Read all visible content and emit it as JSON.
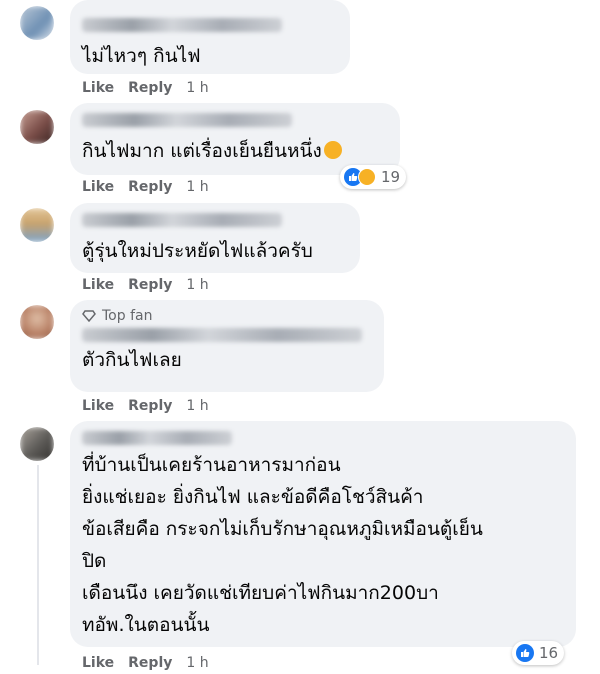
{
  "comments": [
    {
      "text": "ไม่ไหวๆ กินไฟ",
      "actions": {
        "like": "Like",
        "reply": "Reply",
        "time": "1 h"
      },
      "avatar_colors": [
        "#6d8fb3",
        "#b9c7d6"
      ]
    },
    {
      "text": "กินไฟมาก แต่เรื่องเย็นยืนหนึ่ง",
      "actions": {
        "like": "Like",
        "reply": "Reply",
        "time": "1 h"
      },
      "reactions": {
        "count": "19",
        "icons": [
          "like-icon",
          "haha-icon"
        ]
      },
      "avatar_colors": [
        "#7a4d48",
        "#c79f94"
      ]
    },
    {
      "text": "ตู้รุ่นใหม่ประหยัดไฟแล้วครับ",
      "actions": {
        "like": "Like",
        "reply": "Reply",
        "time": "1 h"
      },
      "avatar_colors": [
        "#c9a26b",
        "#7ca3c9"
      ]
    },
    {
      "badge": "Top fan",
      "text": "ตัวกินไฟเลย",
      "actions": {
        "like": "Like",
        "reply": "Reply",
        "time": "1 h"
      },
      "avatar_colors": [
        "#b77e63",
        "#e0c0a8"
      ]
    },
    {
      "text": "ที่บ้านเป็นเคยร้านอาหารมาก่อน\nยิ่งแช่เยอะ ยิ่งกินไฟ และข้อดีคือโชว์สินค้า\nข้อเสียคือ กระจกไม่เก็บรักษาอุณหภูมิเหมือนตู้เย็น\nปิด\nเดือนนึง เคยวัดแช่เทียบค่าไฟกินมาก200บา\nทอัพ.ในตอนนั้น",
      "actions": {
        "like": "Like",
        "reply": "Reply",
        "time": "1 h"
      },
      "reactions": {
        "count": "16",
        "icons": [
          "like-icon"
        ]
      },
      "avatar_colors": [
        "#5c5a57",
        "#a9a39b"
      ]
    }
  ],
  "colors": {
    "bubble": "#f0f2f5",
    "meta": "#65676b",
    "like_blue": "#1877f2"
  }
}
